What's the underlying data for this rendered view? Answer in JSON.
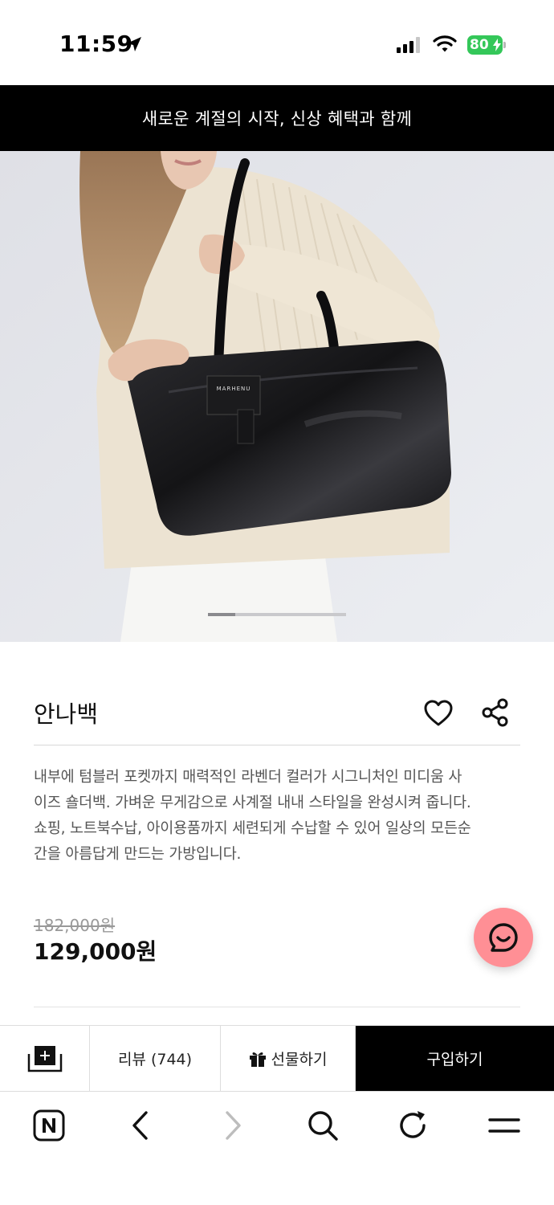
{
  "status_bar": {
    "time": "11:59",
    "battery_level": "80",
    "icons": [
      "location-arrow-icon",
      "cellular-signal-icon",
      "wifi-icon",
      "battery-icon"
    ]
  },
  "promo_banner": {
    "text": "새로운 계절의 시작, 신상 혜택과 함께"
  },
  "hero": {
    "bag_label": "MARHENU",
    "carousel_position": 0.2
  },
  "product": {
    "title": "안나백",
    "description_lines": [
      "내부에 텀블러 포켓까지 매력적인 라벤더 컬러가 시그니처인 미디움 사",
      "이즈 숄더백. 가벼운 무게감으로 사계절 내내 스타일을 완성시켜 줍니다.",
      "쇼핑, 노트북수납, 아이용품까지 세련되게 수납할 수 있어 일상의 모든순",
      "간을 아름답게 만드는 가방입니다."
    ],
    "original_price": "182,000원",
    "sale_price": "129,000원"
  },
  "action_bar": {
    "review_label": "리뷰 (744)",
    "gift_label": "선물하기",
    "buy_label": "구입하기"
  },
  "browser_toolbar": {
    "icons": [
      "naver-home-icon",
      "back-icon",
      "forward-icon",
      "search-icon",
      "reload-icon",
      "menu-icon"
    ]
  },
  "colors": {
    "banner_bg": "#000000",
    "chat_fab": "#ff8f95",
    "battery": "#34c759",
    "buy_button": "#000000"
  }
}
